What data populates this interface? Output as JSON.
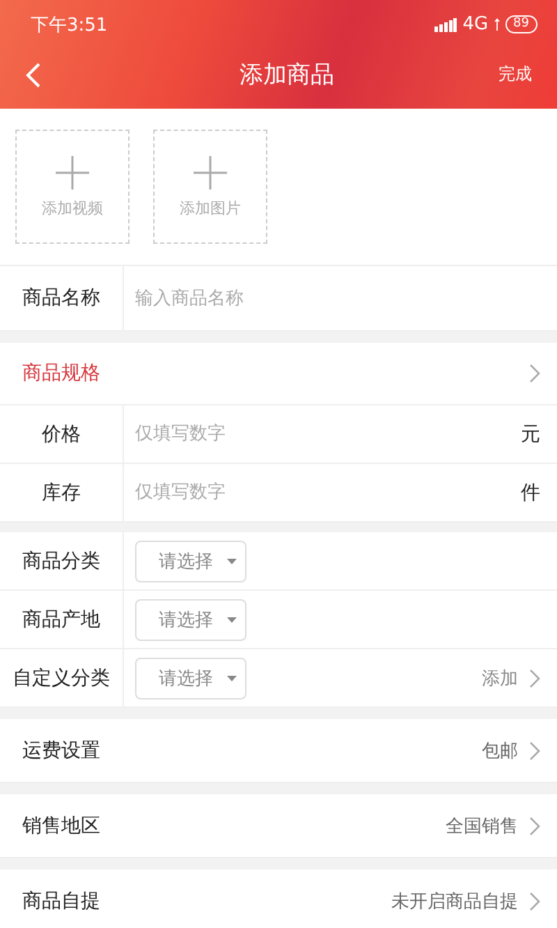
{
  "status_bar": {
    "time": "下午3:51",
    "network": "4G",
    "battery": "89"
  },
  "nav": {
    "title": "添加商品",
    "action": "完成"
  },
  "media": [
    {
      "label": "添加视频"
    },
    {
      "label": "添加图片"
    }
  ],
  "name_field": {
    "label": "商品名称",
    "placeholder": "输入商品名称"
  },
  "spec": {
    "label": "商品规格"
  },
  "spec_fields": [
    {
      "label": "价格",
      "placeholder": "仅填写数字",
      "unit": "元"
    },
    {
      "label": "库存",
      "placeholder": "仅填写数字",
      "unit": "件"
    }
  ],
  "selects": [
    {
      "label": "商品分类",
      "value": "请选择"
    },
    {
      "label": "商品产地",
      "value": "请选择"
    },
    {
      "label": "自定义分类",
      "value": "请选择",
      "action": "添加"
    }
  ],
  "settings": [
    {
      "label": "运费设置",
      "value": "包邮"
    },
    {
      "label": "销售地区",
      "value": "全国销售"
    },
    {
      "label": "商品自提",
      "value": "未开启商品自提"
    }
  ]
}
